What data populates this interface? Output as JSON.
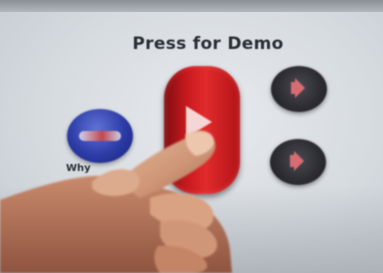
{
  "demo_label": "Press for Demo",
  "why_label": "Why",
  "icons": {
    "logo_button": "globe-logo-icon",
    "demo_button": "play-icon",
    "speaker_upper": "speaker-icon",
    "speaker_lower": "speaker-icon"
  },
  "colors": {
    "demo_button": "#d21f22",
    "logo_button": "#2c3ba6",
    "speaker_buttons": "#2d2d33",
    "panel": "#dde1e5"
  }
}
